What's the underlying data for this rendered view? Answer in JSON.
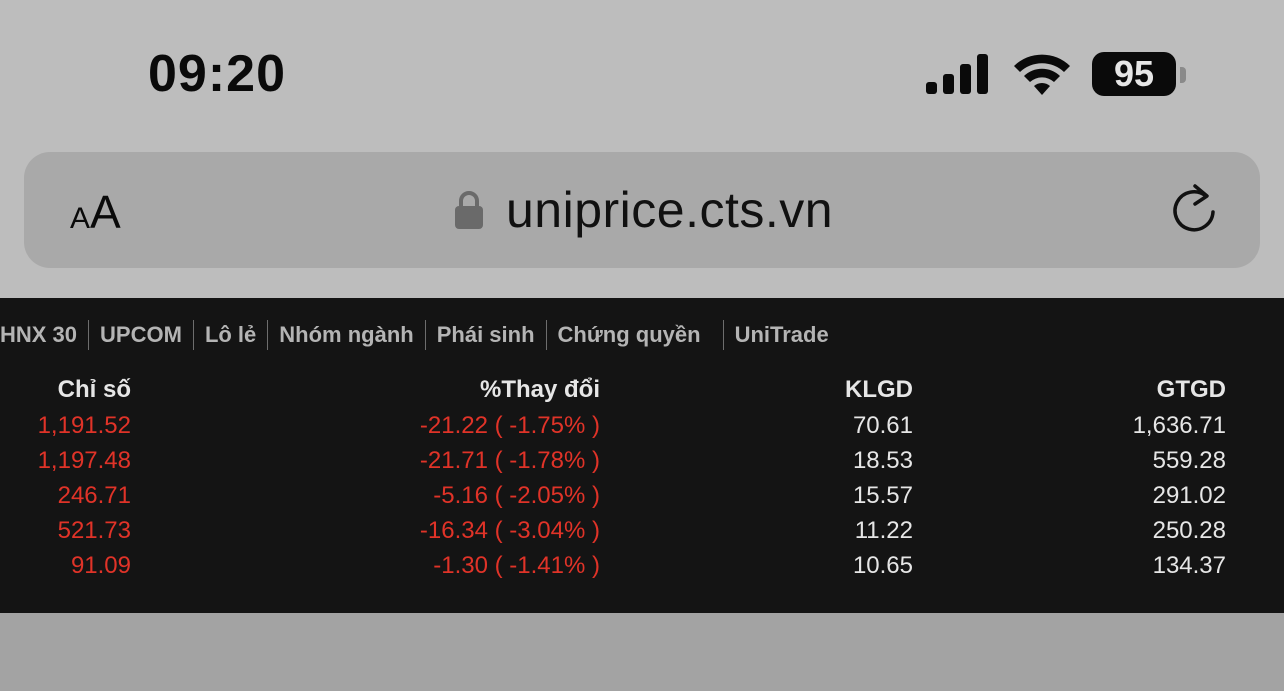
{
  "status_bar": {
    "time": "09:20",
    "battery": "95"
  },
  "browser": {
    "text_size_button": {
      "small": "A",
      "large": "A"
    },
    "url": "uniprice.cts.vn"
  },
  "market_tabs": [
    "HNX 30",
    "UPCOM",
    "Lô lẻ",
    "Nhóm ngành",
    "Phái sinh",
    "Chứng quyền",
    "UniTrade"
  ],
  "table": {
    "headers": [
      "Chỉ số",
      "%Thay đổi",
      "KLGD",
      "GTGD"
    ],
    "rows": [
      {
        "index": "1,191.52",
        "change": "-21.22 ( -1.75% )",
        "volume": "70.61",
        "value": "1,636.71"
      },
      {
        "index": "1,197.48",
        "change": "-21.71 ( -1.78% )",
        "volume": "18.53",
        "value": "559.28"
      },
      {
        "index": "246.71",
        "change": "-5.16 ( -2.05% )",
        "volume": "15.57",
        "value": "291.02"
      },
      {
        "index": "521.73",
        "change": "-16.34 ( -3.04% )",
        "volume": "11.22",
        "value": "250.28"
      },
      {
        "index": "91.09",
        "change": "-1.30 ( -1.41% )",
        "volume": "10.65",
        "value": "134.37"
      }
    ]
  },
  "colors": {
    "decrease": "#e03328",
    "panel_background": "#141414"
  },
  "icons": [
    "signal-icon",
    "wifi-icon",
    "lock-icon",
    "reload-icon"
  ]
}
